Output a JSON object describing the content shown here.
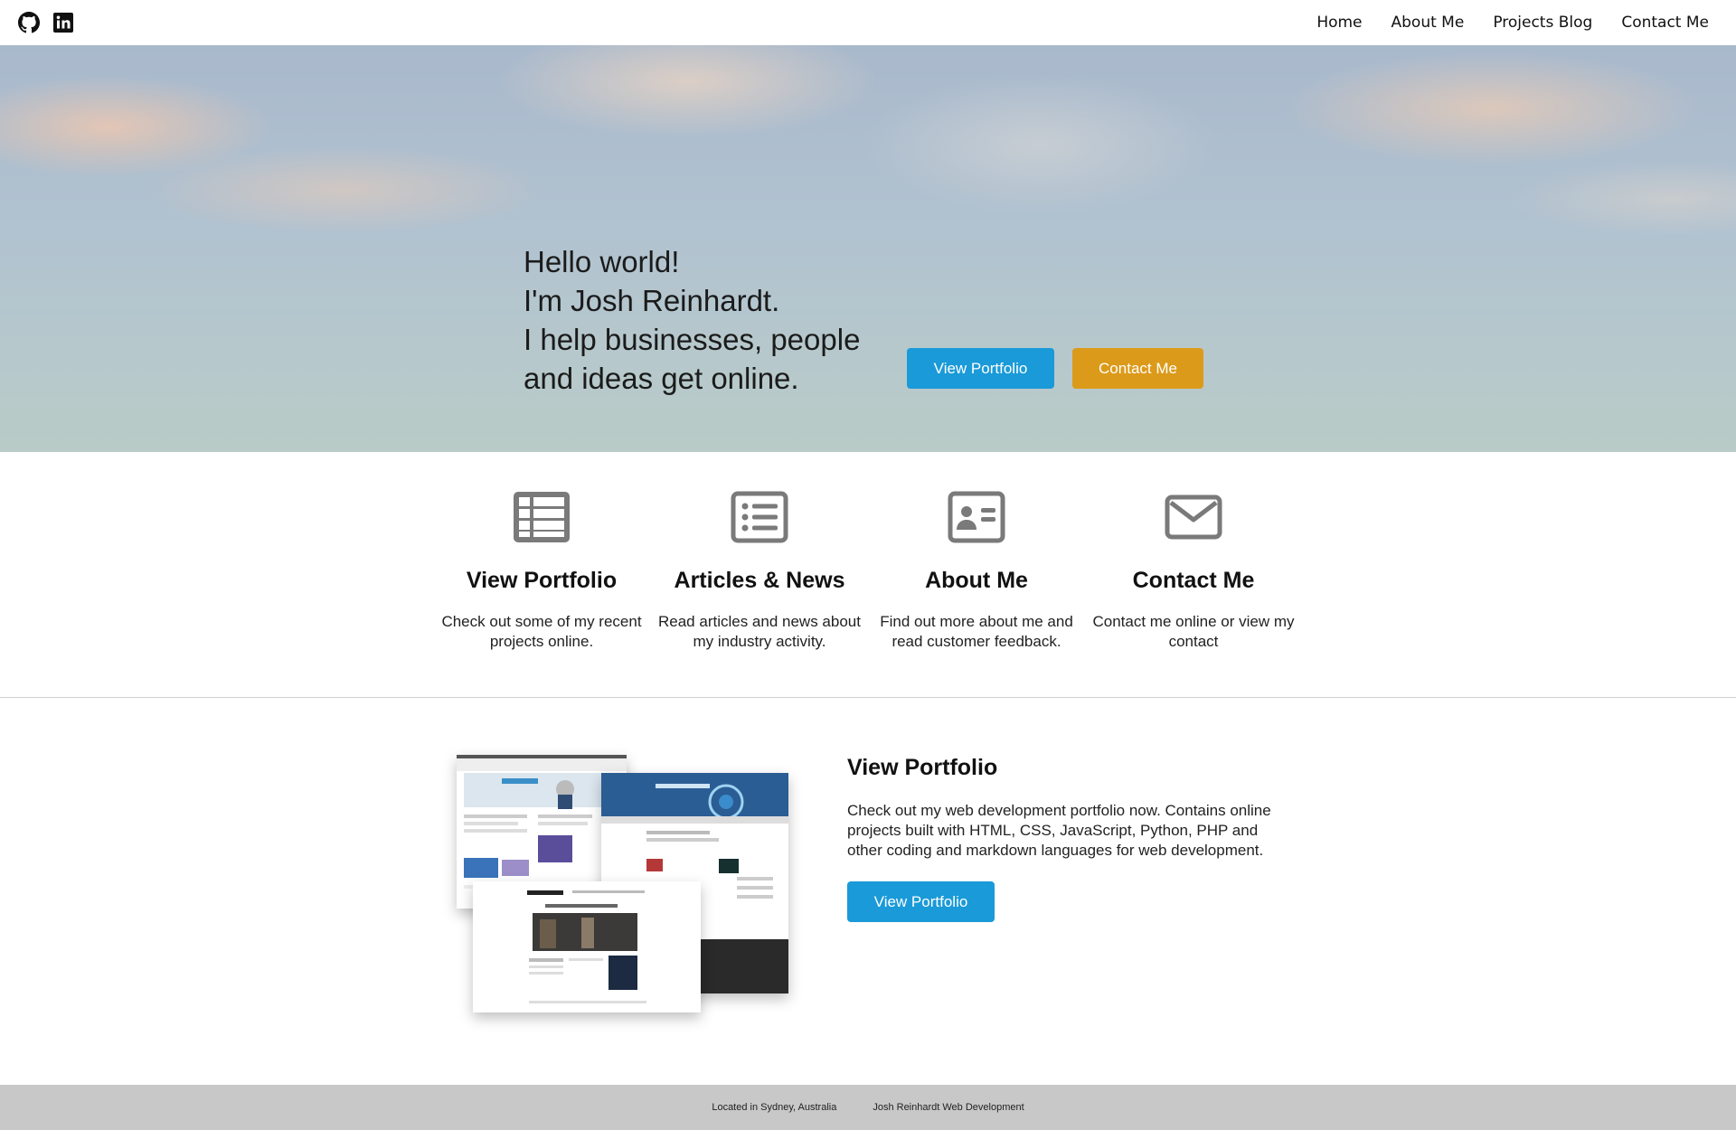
{
  "navbar": {
    "social": [
      {
        "icon": "github-icon"
      },
      {
        "icon": "linkedin-icon"
      }
    ],
    "links": [
      "Home",
      "About Me",
      "Projects Blog",
      "Contact Me"
    ]
  },
  "hero": {
    "lines": [
      "Hello world!",
      "I'm Josh Reinhardt.",
      "I help businesses, people",
      "and ideas get online."
    ],
    "primary_button": "View Portfolio",
    "secondary_button": "Contact Me"
  },
  "features": [
    {
      "icon": "table-list-icon",
      "title": "View Portfolio",
      "text": "Check out some of my recent projects online."
    },
    {
      "icon": "list-icon",
      "title": "Articles & News",
      "text": "Read articles and news about my industry activity."
    },
    {
      "icon": "id-card-icon",
      "title": "About Me",
      "text": "Find out more about me and read customer feedback."
    },
    {
      "icon": "envelope-icon",
      "title": "Contact Me",
      "text": "Contact me online or view my contact"
    }
  ],
  "portfolio": {
    "title": "View Portfolio",
    "text": "Check out my web development portfolio now. Contains online projects built with HTML, CSS, JavaScript, Python, PHP and other coding and markdown languages for web development.",
    "button": "View Portfolio"
  },
  "footer": {
    "location": "Located in Sydney, Australia",
    "brand": "Josh Reinhardt Web Development"
  },
  "colors": {
    "accent_blue": "#1a9ad8",
    "accent_gold": "#dc9a1a",
    "icon_gray": "#7a7a7a",
    "footer_bg": "#c8c8c8"
  }
}
